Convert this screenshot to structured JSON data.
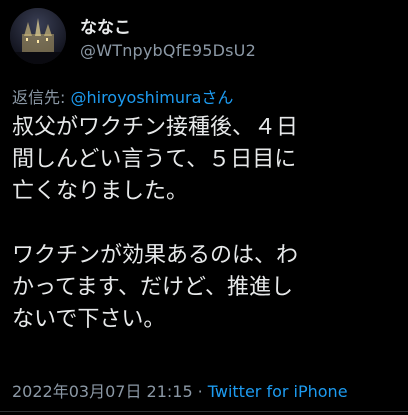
{
  "user": {
    "display_name": "ななこ",
    "handle": "@WTnpybQfE95DsU2"
  },
  "reply": {
    "prefix": "返信先: ",
    "mention": "@hiroyoshimura",
    "suffix": "さん"
  },
  "tweet": {
    "lines": [
      "叔父がワクチン接種後、４日",
      "間しんどい言うて、５日目に",
      "亡くなりました。",
      "",
      "ワクチンが効果あるのは、わ",
      "かってます、だけど、推進し",
      "ないで下さい。"
    ]
  },
  "meta": {
    "timestamp": "2022年03月07日 21:15",
    "separator": "·",
    "source": "Twitter for iPhone"
  },
  "colors": {
    "background": "#000000",
    "text": "#e7e9ea",
    "secondary": "#8b98a5",
    "accent": "#1d9bf0"
  }
}
